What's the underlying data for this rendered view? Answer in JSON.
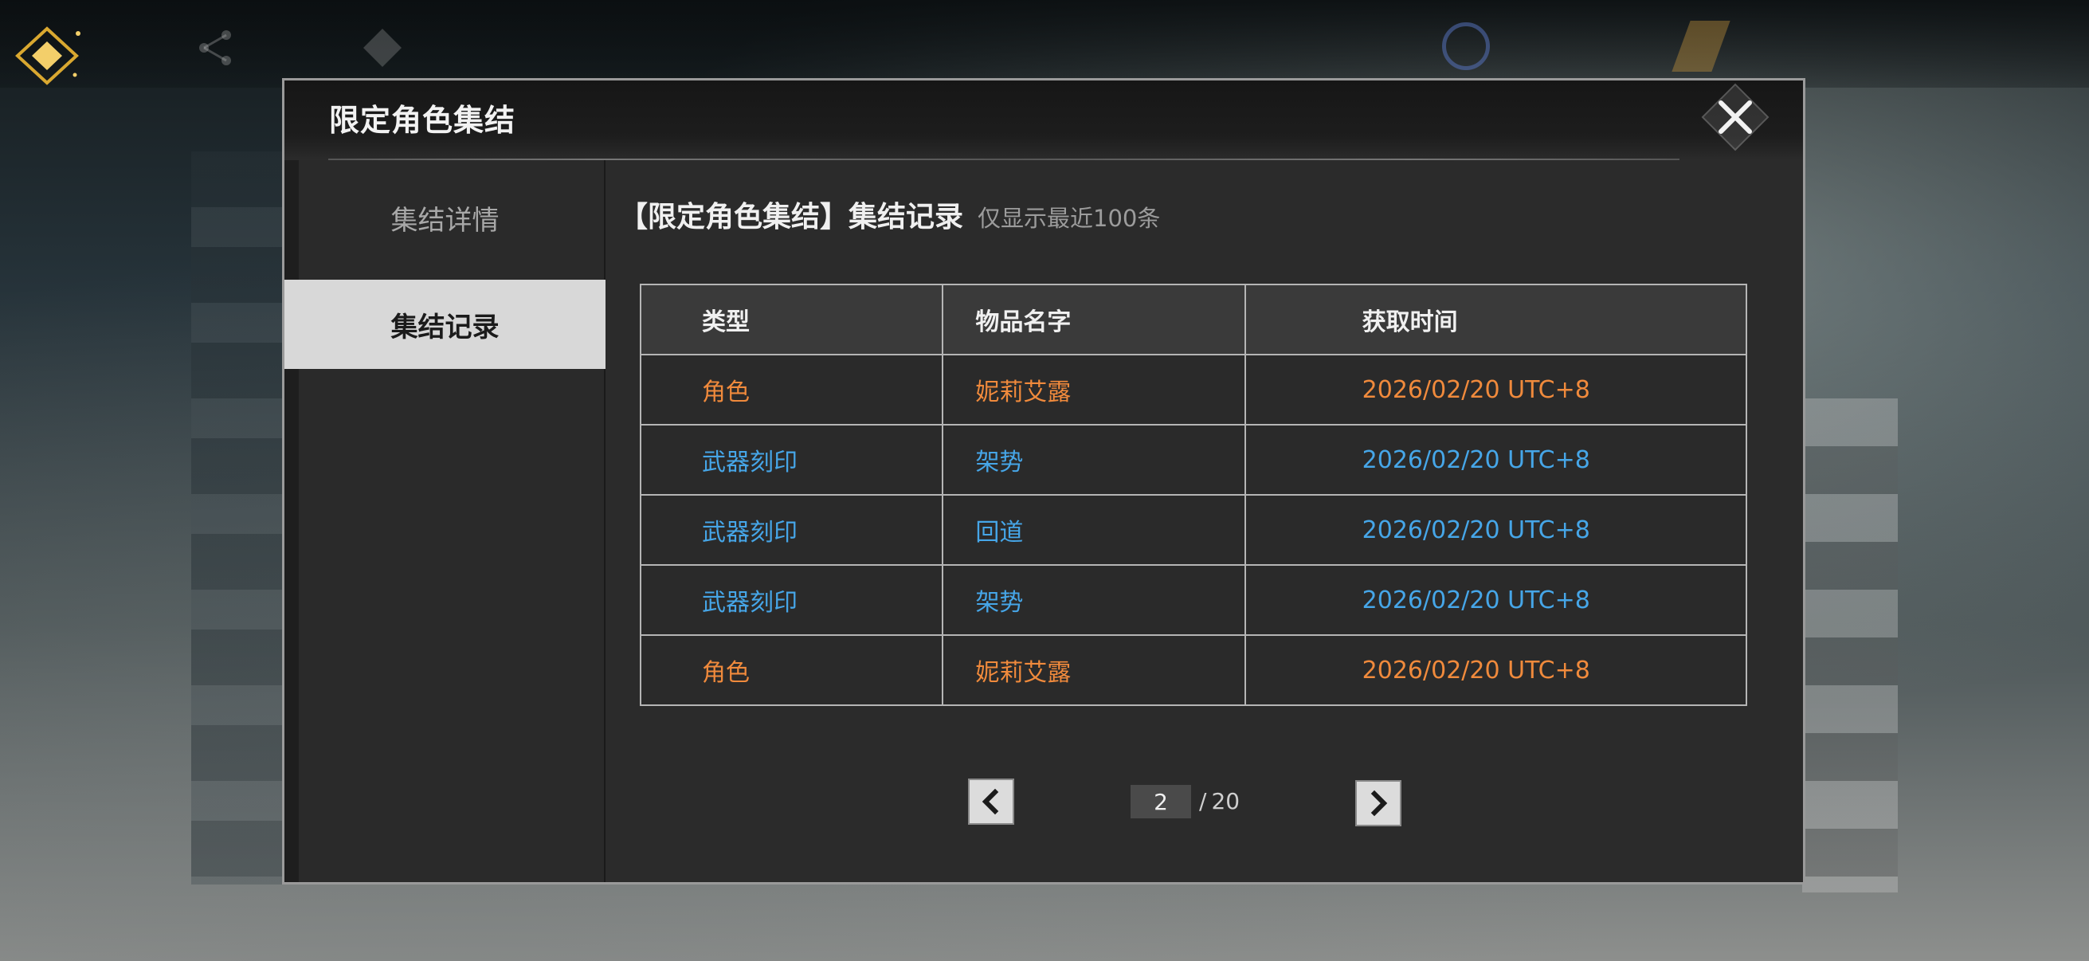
{
  "modal": {
    "title": "限定角色集结"
  },
  "sidebar": {
    "items": [
      {
        "label": "集结详情",
        "selected": false
      },
      {
        "label": "集结记录",
        "selected": true
      }
    ]
  },
  "content": {
    "heading": "【限定角色集结】集结记录",
    "note": "仅显示最近100条"
  },
  "table": {
    "headers": [
      "类型",
      "物品名字",
      "获取时间"
    ],
    "rows": [
      {
        "type": "角色",
        "name": "妮莉艾露",
        "time": "2026/02/20 UTC+8",
        "color": "#f08a3c"
      },
      {
        "type": "武器刻印",
        "name": "架势",
        "time": "2026/02/20 UTC+8",
        "color": "#46a6e8"
      },
      {
        "type": "武器刻印",
        "name": "回道",
        "time": "2026/02/20 UTC+8",
        "color": "#46a6e8"
      },
      {
        "type": "武器刻印",
        "name": "架势",
        "time": "2026/02/20 UTC+8",
        "color": "#46a6e8"
      },
      {
        "type": "角色",
        "name": "妮莉艾露",
        "time": "2026/02/20 UTC+8",
        "color": "#f08a3c"
      }
    ]
  },
  "pagination": {
    "current": "2",
    "slash": "/",
    "total": "20"
  },
  "icons": {
    "close": "close-icon",
    "prev": "chevron-left-icon",
    "next": "chevron-right-icon",
    "logo": "gold-diamond-icon"
  },
  "colors": {
    "orange": "#f08a3c",
    "blue": "#46a6e8",
    "selected_tab_bg": "#d8d8d8"
  }
}
